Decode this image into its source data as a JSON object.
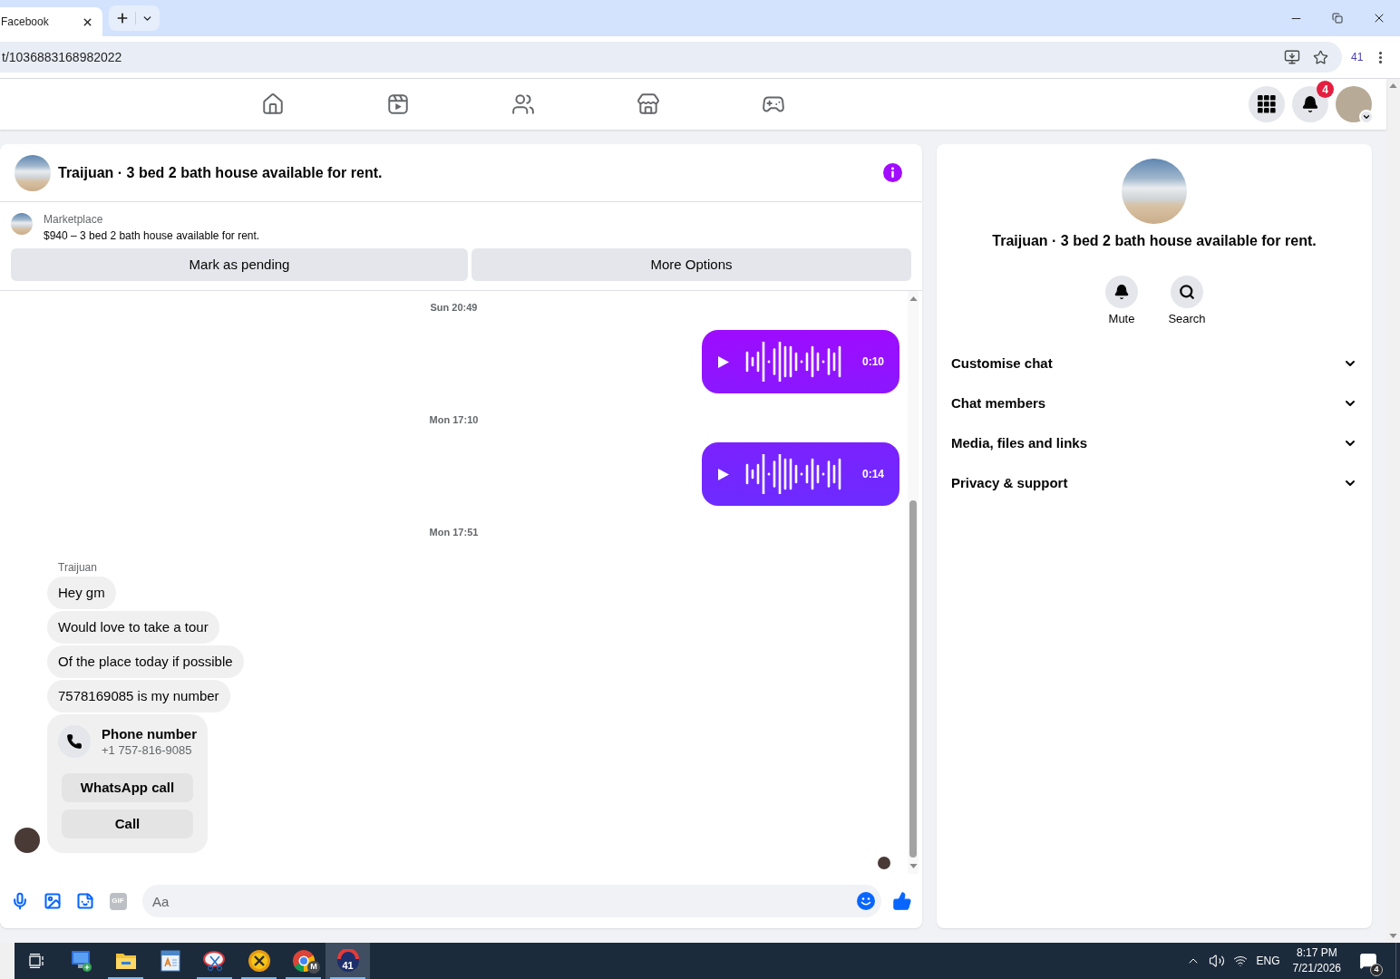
{
  "browser": {
    "tab": {
      "title": "Facebook",
      "selected": true
    },
    "address": "t/1036883168982022",
    "extension_badge": "41"
  },
  "top_nav": {
    "tabs": [
      {
        "kind": "home",
        "selected": false
      },
      {
        "kind": "video",
        "selected": false
      },
      {
        "kind": "friends",
        "selected": false
      },
      {
        "kind": "marketplace",
        "selected": false
      },
      {
        "kind": "gaming",
        "selected": false
      }
    ],
    "notification_count": "4"
  },
  "chat": {
    "title": "Traijuan · 3 bed 2 bath house available for rent.",
    "listing": {
      "source": "Marketplace",
      "summary": "$940 – 3 bed 2 bath house available for rent."
    },
    "actions": [
      "Mark as pending",
      "More Options"
    ],
    "thread": [
      {
        "kind": "timestamp",
        "text": "Sun 20:49"
      },
      {
        "kind": "voice",
        "duration": "0:10"
      },
      {
        "kind": "timestamp",
        "text": "Mon 17:10"
      },
      {
        "kind": "voice",
        "duration": "0:14"
      },
      {
        "kind": "timestamp",
        "text": "Mon 17:51"
      },
      {
        "kind": "incoming",
        "sender": "Traijuan",
        "items": [
          {
            "kind": "text",
            "text": "Hey gm"
          },
          {
            "kind": "text",
            "text": "Would love to take a tour"
          },
          {
            "kind": "text",
            "text": "Of the place today if possible"
          },
          {
            "kind": "text",
            "text": "7578169085 is my number"
          },
          {
            "kind": "contact",
            "title": "Phone number",
            "number": "+1 757-816-9085",
            "buttons": [
              "WhatsApp call",
              "Call"
            ]
          }
        ]
      }
    ],
    "composer": {
      "gif_label": "GIF",
      "placeholder": "Aa"
    }
  },
  "details": {
    "title": "Traijuan · 3 bed 2 bath house available for rent.",
    "actions": [
      {
        "kind": "mute",
        "label": "Mute"
      },
      {
        "kind": "search",
        "label": "Search"
      }
    ],
    "sections": [
      {
        "label": "Customise chat",
        "expanded": false
      },
      {
        "label": "Chat members",
        "expanded": false
      },
      {
        "label": "Media, files and links",
        "expanded": false
      },
      {
        "label": "Privacy & support",
        "expanded": false
      }
    ]
  },
  "taskbar": {
    "apps": [
      {
        "kind": "remote_desktop",
        "running": false,
        "selected": false
      },
      {
        "kind": "file_explorer",
        "running": true,
        "selected": false
      },
      {
        "kind": "wordpad",
        "running": false,
        "selected": false
      },
      {
        "kind": "snipping_tool",
        "running": true,
        "selected": false
      },
      {
        "kind": "ix",
        "running": true,
        "selected": false
      },
      {
        "kind": "chrome",
        "running": true,
        "selected": false,
        "badge": "M"
      },
      {
        "kind": "dial",
        "running": true,
        "selected": true,
        "badge": "41"
      }
    ],
    "language": "ENG",
    "time": "8:17 PM",
    "date": "7/21/2026",
    "notification_count": "4"
  }
}
